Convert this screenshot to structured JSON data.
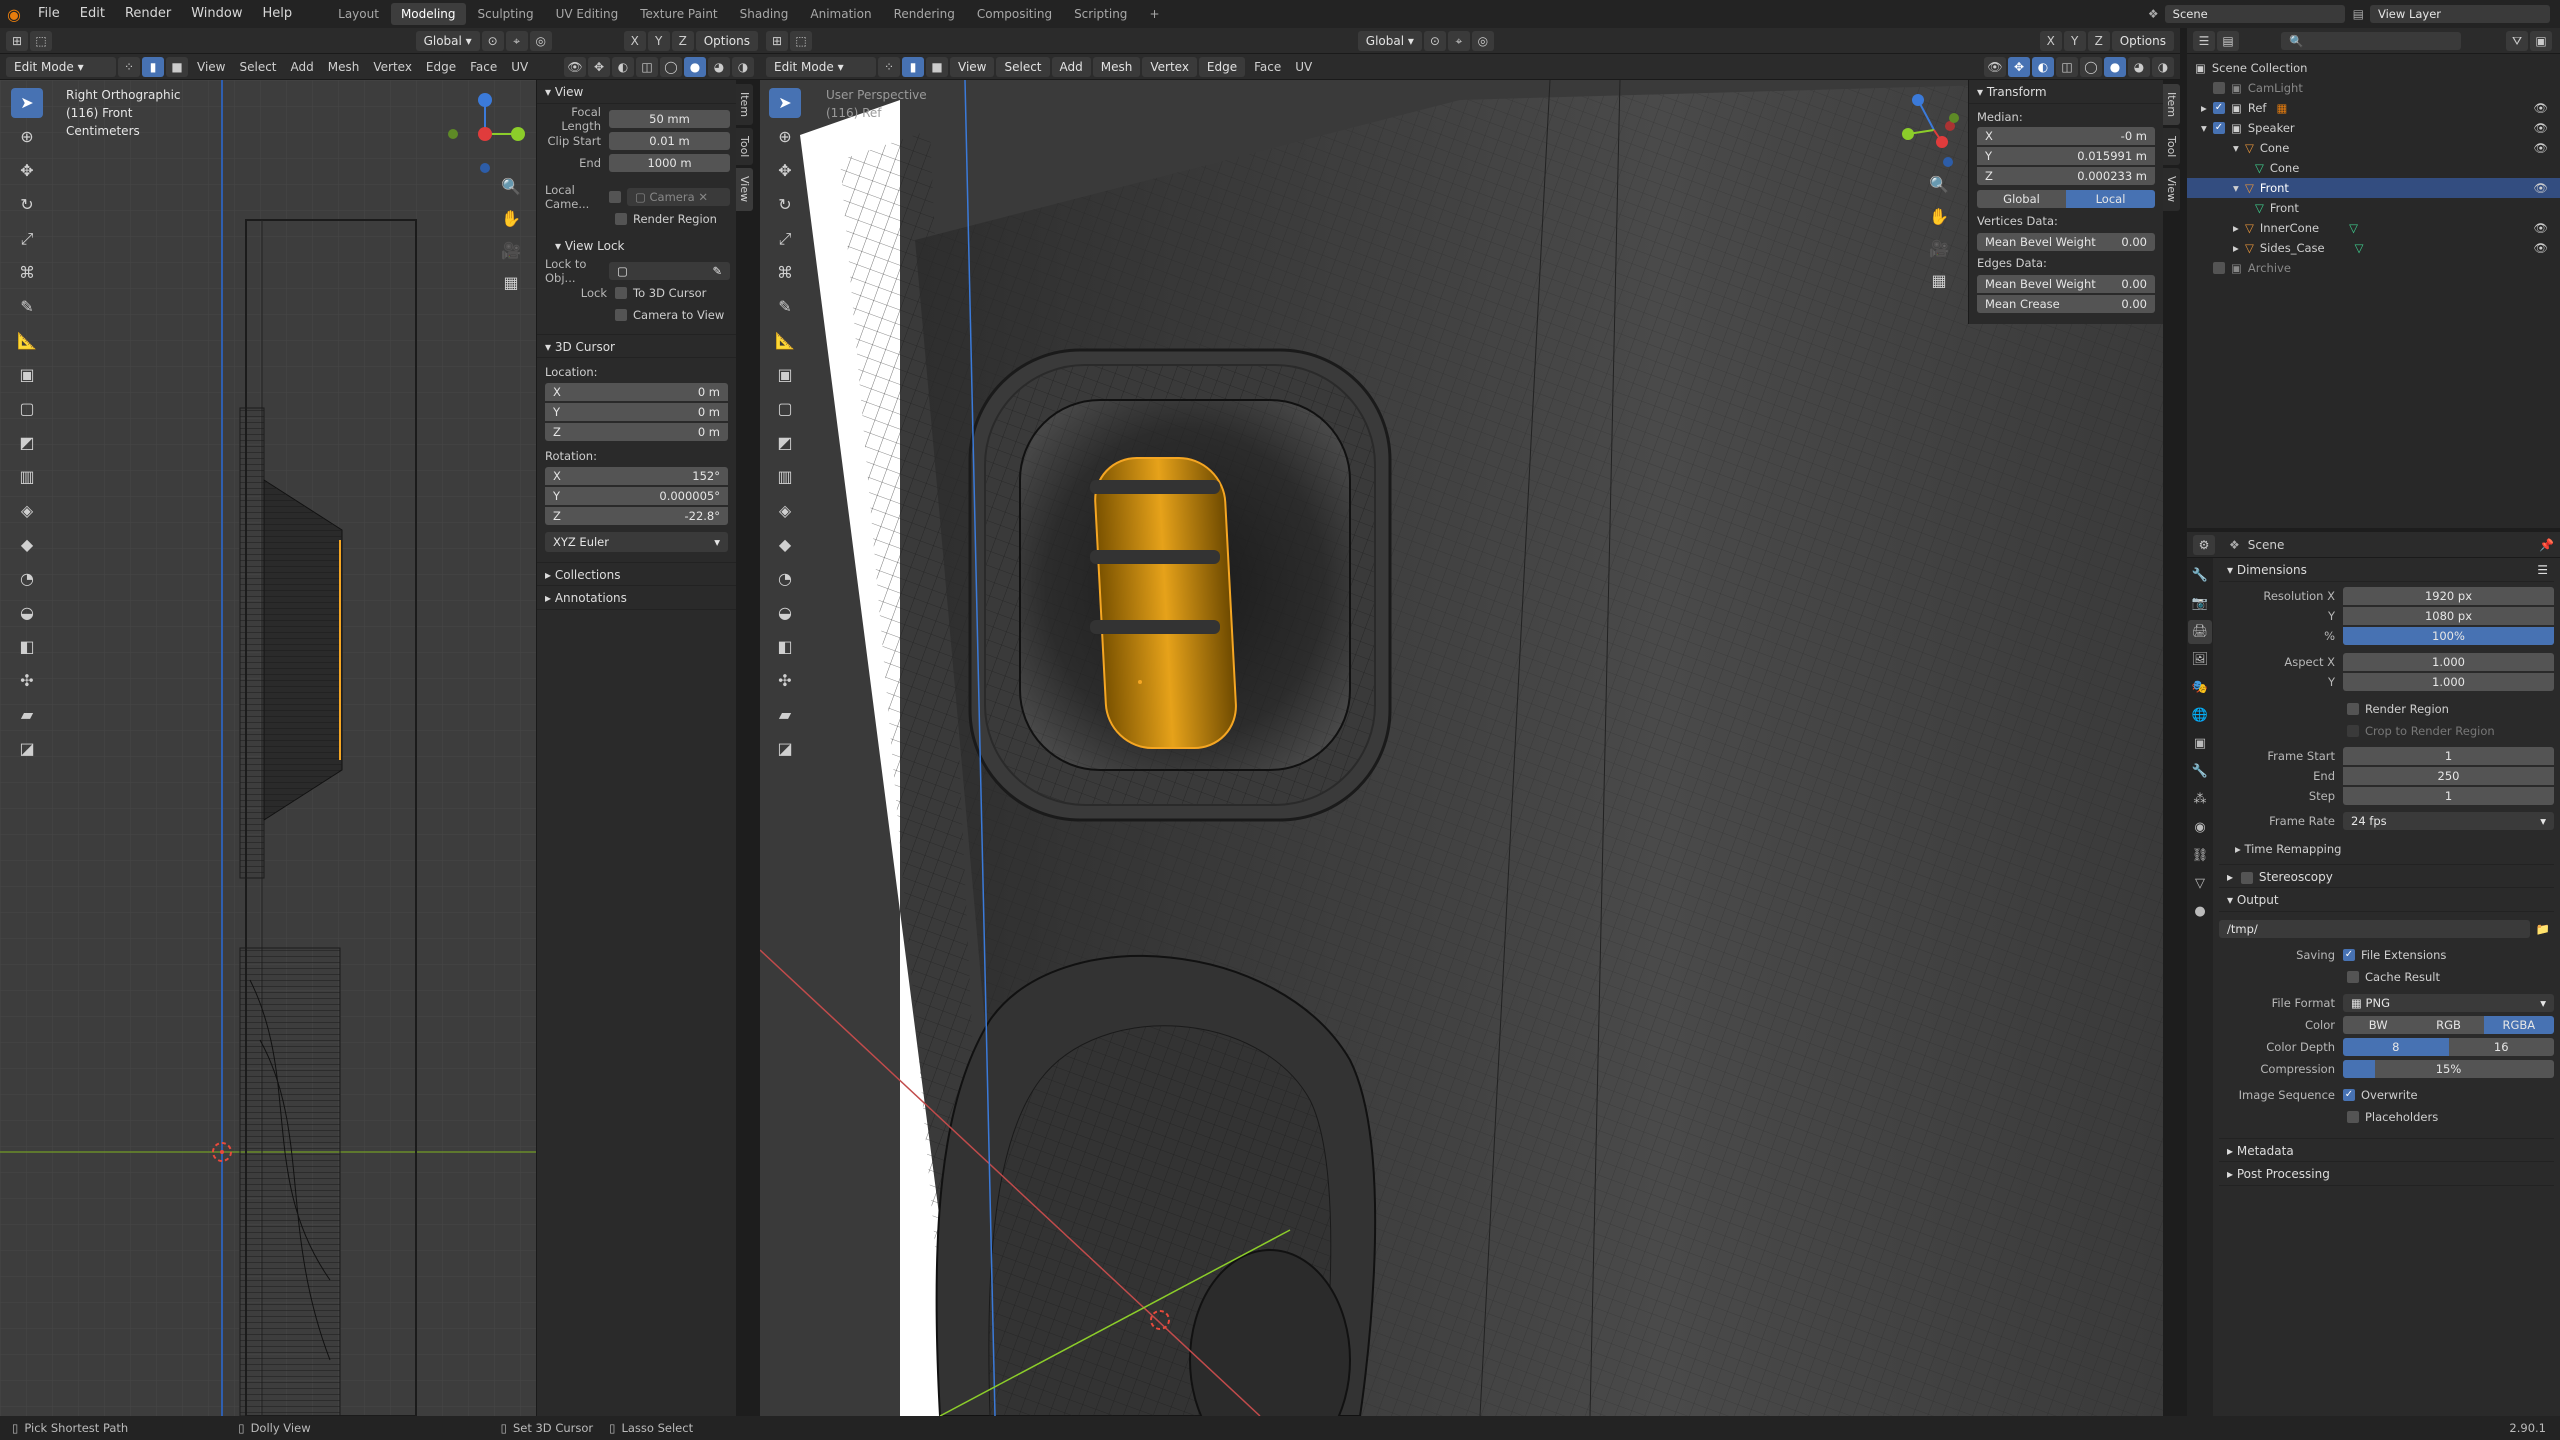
{
  "app": {
    "menus": [
      "File",
      "Edit",
      "Render",
      "Window",
      "Help"
    ],
    "workspaces": [
      "Layout",
      "Modeling",
      "Sculpting",
      "UV Editing",
      "Texture Paint",
      "Shading",
      "Animation",
      "Rendering",
      "Compositing",
      "Scripting"
    ],
    "active_workspace": "Modeling",
    "scene": "Scene",
    "view_layer": "View Layer"
  },
  "left_view": {
    "mode": "Edit Mode",
    "orientation": "Global",
    "menus": [
      "View",
      "Select",
      "Add",
      "Mesh",
      "Vertex",
      "Edge",
      "Face",
      "UV"
    ],
    "options": "Options",
    "overlay_title": "Right Orthographic",
    "overlay_object": "(116) Front",
    "overlay_units": "Centimeters",
    "npanel": {
      "tabs": [
        "Item",
        "Tool",
        "View"
      ],
      "view_title": "View",
      "focal_length_label": "Focal Length",
      "focal_length": "50 mm",
      "clip_start_label": "Clip Start",
      "clip_start": "0.01 m",
      "end_label": "End",
      "clip_end": "1000 m",
      "local_camera_label": "Local Came...",
      "camera_placeholder": "Camera",
      "render_region": "Render Region",
      "view_lock_title": "View Lock",
      "lock_to_obj_label": "Lock to Obj...",
      "lock_label": "Lock",
      "to_3d_cursor": "To 3D Cursor",
      "camera_to_view": "Camera to View",
      "cursor_title": "3D Cursor",
      "location_label": "Location:",
      "loc_x": "0 m",
      "loc_y": "0 m",
      "loc_z": "0 m",
      "rotation_label": "Rotation:",
      "rot_x": "152°",
      "rot_y": "0.000005°",
      "rot_z": "-22.8°",
      "rotation_mode": "XYZ Euler",
      "collections": "Collections",
      "annotations": "Annotations"
    }
  },
  "right_view": {
    "mode": "Edit Mode",
    "orientation": "Global",
    "menus": [
      "View",
      "Select",
      "Add",
      "Mesh",
      "Vertex",
      "Edge",
      "Face",
      "UV"
    ],
    "options": "Options",
    "overlay_title": "User Perspective",
    "overlay_object": "(116) Ref",
    "npanel": {
      "tabs": [
        "Item",
        "Tool",
        "View"
      ],
      "transform_title": "Transform",
      "median_label": "Median:",
      "x_label": "X",
      "x": "-0 m",
      "y_label": "Y",
      "y": "0.015991 m",
      "z_label": "Z",
      "z": "0.000233 m",
      "global": "Global",
      "local": "Local",
      "vertices_data": "Vertices Data:",
      "edges_data": "Edges Data:",
      "mean_bevel_weight": "Mean Bevel Weight",
      "mean_bevel_value": "0.00",
      "mean_crease": "Mean Crease",
      "mean_crease_value": "0.00"
    }
  },
  "outliner": {
    "root": "Scene Collection",
    "items": [
      "CamLight",
      "Ref",
      "Speaker",
      "Cone",
      "Cone",
      "Front",
      "Front",
      "InnerCone",
      "Sides_Case",
      "Archive"
    ]
  },
  "properties": {
    "scene": "Scene",
    "dimensions_title": "Dimensions",
    "res_x_label": "Resolution X",
    "res_x": "1920 px",
    "y_label": "Y",
    "res_y": "1080 px",
    "pct_label": "%",
    "res_pct": "100%",
    "res_pct_value": 1.0,
    "aspect_x_label": "Aspect X",
    "aspect_x": "1.000",
    "aspect_y": "1.000",
    "render_region": "Render Region",
    "crop_region": "Crop to Render Region",
    "frame_start_label": "Frame Start",
    "frame_start": "1",
    "end_label": "End",
    "frame_end": "250",
    "step_label": "Step",
    "frame_step": "1",
    "frame_rate_label": "Frame Rate",
    "frame_rate": "24 fps",
    "time_remapping": "Time Remapping",
    "stereoscopy": "Stereoscopy",
    "output_title": "Output",
    "output_path": "/tmp/",
    "saving_label": "Saving",
    "file_extensions": "File Extensions",
    "cache_result": "Cache Result",
    "file_format_label": "File Format",
    "file_format": "PNG",
    "color_label": "Color",
    "color_bw": "BW",
    "color_rgb": "RGB",
    "color_rgba": "RGBA",
    "color_depth_label": "Color Depth",
    "depth_8": "8",
    "depth_16": "16",
    "compression_label": "Compression",
    "compression": "15%",
    "compression_value": 0.15,
    "image_sequence_label": "Image Sequence",
    "overwrite": "Overwrite",
    "placeholders": "Placeholders",
    "metadata": "Metadata",
    "post_processing": "Post Processing"
  },
  "status": {
    "pick_path": "Pick Shortest Path",
    "dolly": "Dolly View",
    "set_cursor": "Set 3D Cursor",
    "lasso": "Lasso Select",
    "version": "2.90.1"
  },
  "colors": {
    "accent": "#4772b3",
    "selected_edge": "#f5a623",
    "x_axis": "#e03c3c",
    "y_axis": "#8ccd2a",
    "z_axis": "#3b7ad9"
  }
}
